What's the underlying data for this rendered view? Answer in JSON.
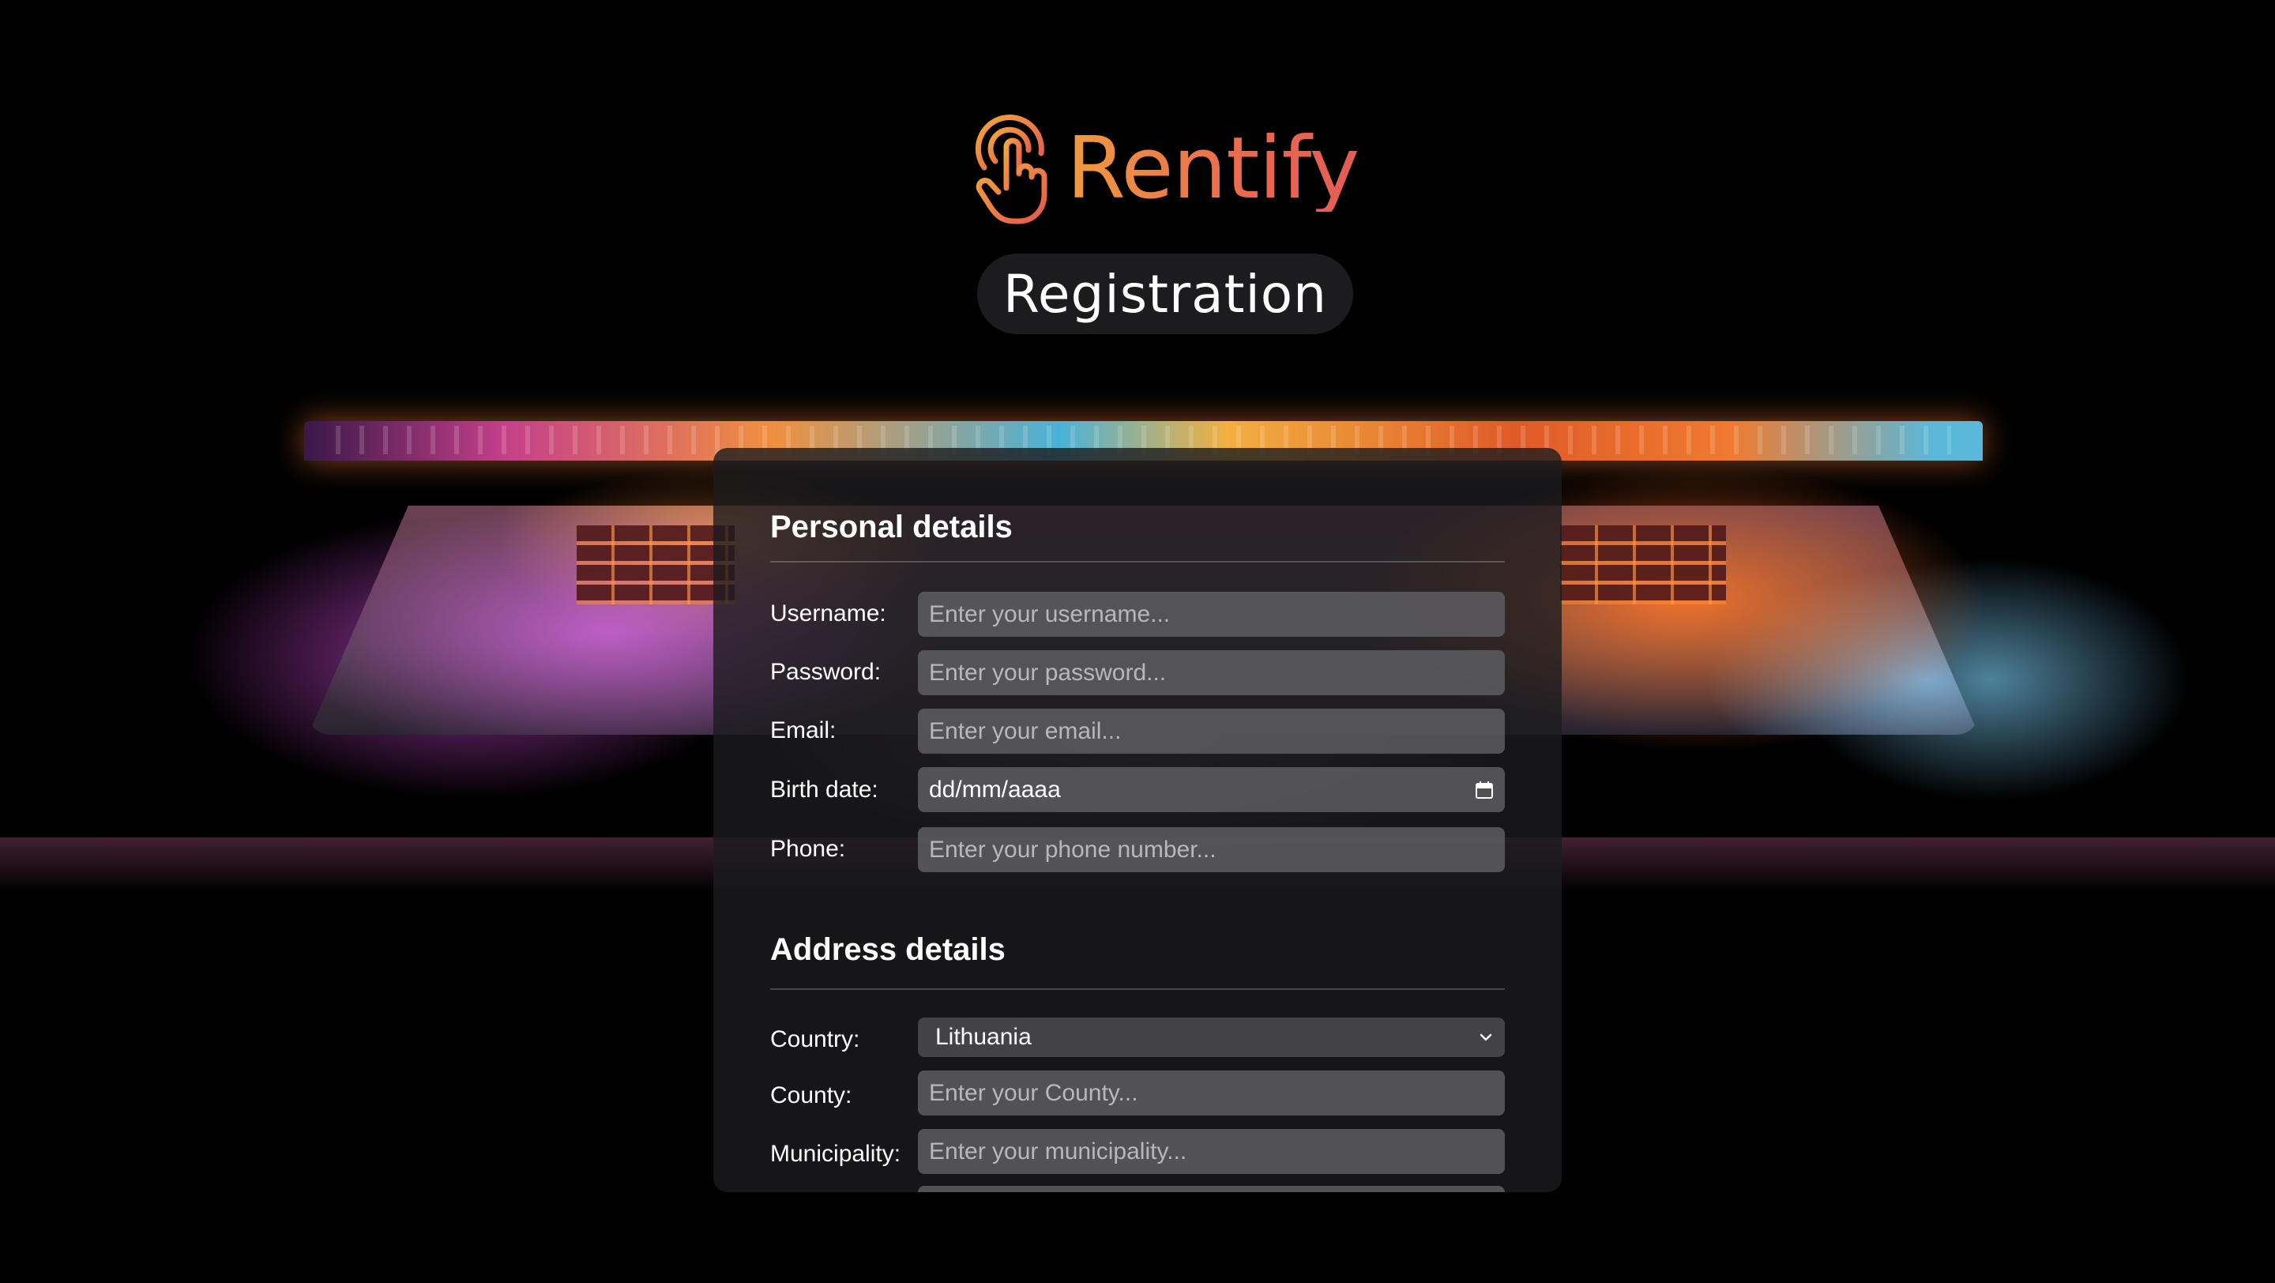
{
  "brand": {
    "name": "Rentify",
    "icon": "pointer-hand-icon",
    "gradient_start": "#f19a3e",
    "gradient_end": "#e45c56"
  },
  "page": {
    "title": "Registration"
  },
  "personal": {
    "title": "Personal details",
    "username": {
      "label": "Username:",
      "placeholder": "Enter your username..."
    },
    "password": {
      "label": "Password:",
      "placeholder": "Enter your password..."
    },
    "email": {
      "label": "Email:",
      "placeholder": "Enter your email..."
    },
    "birth_date": {
      "label": "Birth date:",
      "value": "dd/mm/aaaa",
      "icon": "calendar-icon"
    },
    "phone": {
      "label": "Phone:",
      "placeholder": "Enter your phone number..."
    }
  },
  "address": {
    "title": "Address details",
    "country": {
      "label": "Country:",
      "value": "Lithuania",
      "icon": "chevron-down-icon"
    },
    "county": {
      "label": "County:",
      "placeholder": "Enter your County..."
    },
    "municipality": {
      "label": "Municipality:",
      "placeholder": "Enter your municipality..."
    }
  },
  "colors": {
    "panel_bg": "#1c1c1e",
    "field_bg": "#5f5f64",
    "text": "#ffffff"
  }
}
